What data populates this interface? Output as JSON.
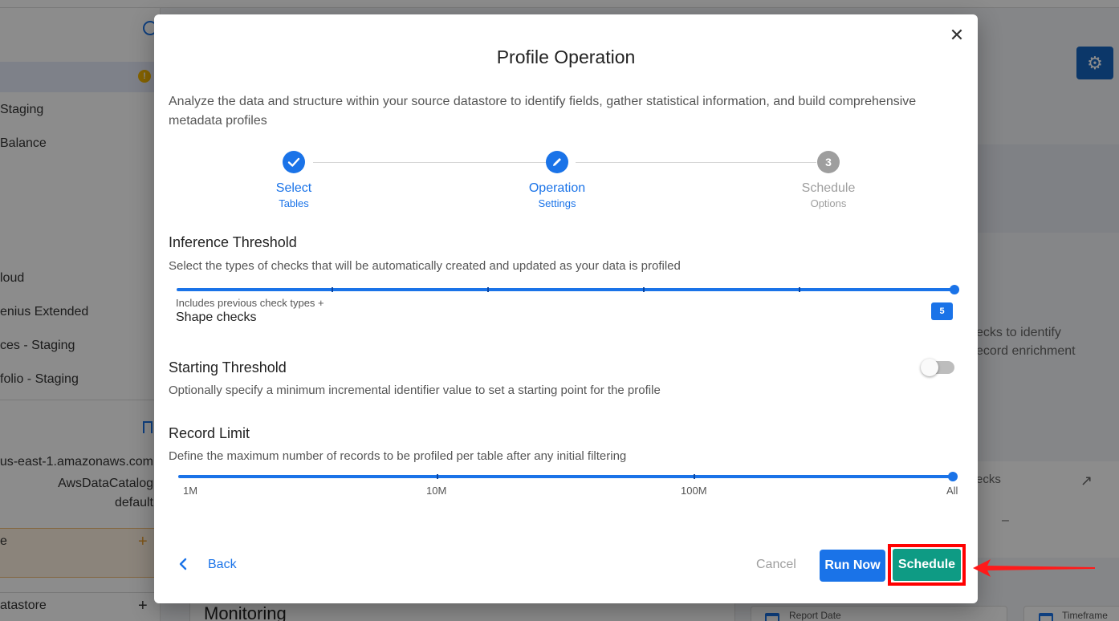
{
  "background": {
    "sidebar_items": [
      "Staging",
      "Balance",
      "loud",
      "enius Extended",
      "ces - Staging",
      "folio - Staging"
    ],
    "connection_lines": [
      "us-east-1.amazonaws.com",
      "AwsDataCatalog",
      "default"
    ],
    "orange_item": "e",
    "bottom_item": "atastore",
    "right_text_1": "ecks to identify",
    "right_text_2": "ecord enrichment",
    "checks_label": "ecks",
    "checks_dash": "–",
    "monitoring_title": "Monitoring",
    "report_date": "Report Date",
    "timeframe": "Timeframe"
  },
  "modal": {
    "title": "Profile Operation",
    "description": "Analyze the data and structure within your source datastore to identify fields, gather statistical information, and build comprehensive metadata profiles",
    "steps": [
      {
        "label": "Select",
        "sub": "Tables",
        "state": "done",
        "icon": "check-icon"
      },
      {
        "label": "Operation",
        "sub": "Settings",
        "state": "active",
        "icon": "pencil-icon"
      },
      {
        "label": "Schedule",
        "sub": "Options",
        "state": "pending",
        "number": "3"
      }
    ],
    "inference": {
      "title": "Inference Threshold",
      "description": "Select the types of checks that will be automatically created and updated as your data is profiled",
      "hint_small": "Includes previous check types +",
      "hint_big": "Shape checks",
      "value": "5",
      "max": 5
    },
    "starting": {
      "title": "Starting Threshold",
      "description": "Optionally specify a minimum incremental identifier value to set a starting point for the profile",
      "enabled": false
    },
    "record_limit": {
      "title": "Record Limit",
      "description": "Define the maximum number of records to be profiled per table after any initial filtering",
      "scale": [
        "1M",
        "10M",
        "100M",
        "All"
      ],
      "selected": "All"
    },
    "buttons": {
      "back": "Back",
      "cancel": "Cancel",
      "run_now": "Run Now",
      "schedule": "Schedule"
    }
  },
  "colors": {
    "accent": "#1a73e8",
    "schedule": "#0e9b84",
    "highlight": "#ff0000"
  }
}
